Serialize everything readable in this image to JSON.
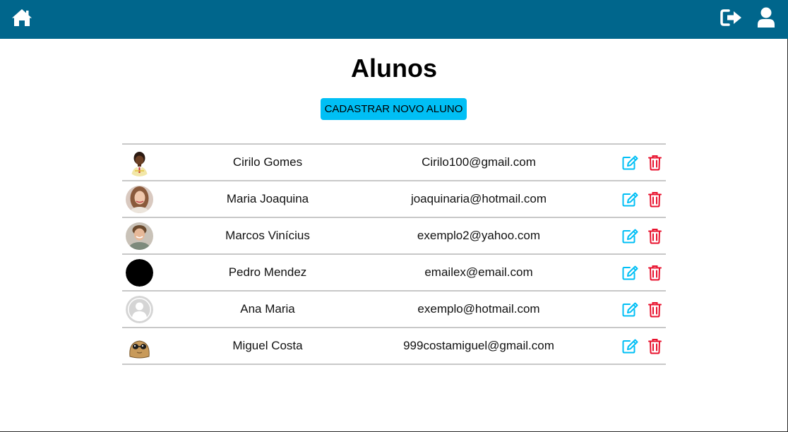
{
  "page": {
    "title": "Alunos"
  },
  "nav": {
    "home_icon": "home-icon",
    "logout_icon": "sign-out-icon",
    "user_icon": "user-icon"
  },
  "actions": {
    "new_student_label": "CADASTRAR NOVO ALUNO"
  },
  "colors": {
    "topbar": "#00668c",
    "button": "#00bff5",
    "edit": "#00bff5",
    "delete": "#e8112d"
  },
  "students": [
    {
      "name": "Cirilo Gomes",
      "email": "Cirilo100@gmail.com",
      "avatar": "child-photo-avatar"
    },
    {
      "name": "Maria Joaquina",
      "email": "joaquinaria@hotmail.com",
      "avatar": "woman-photo-avatar"
    },
    {
      "name": "Marcos Vinícius",
      "email": "exemplo2@yahoo.com",
      "avatar": "boy-photo-avatar"
    },
    {
      "name": "Pedro Mendez",
      "email": "emailex@email.com",
      "avatar": "black-circle-avatar"
    },
    {
      "name": "Ana Maria",
      "email": "exemplo@hotmail.com",
      "avatar": "default-user-avatar"
    },
    {
      "name": "Miguel Costa",
      "email": "999costamiguel@gmail.com",
      "avatar": "pou-character-avatar"
    }
  ]
}
